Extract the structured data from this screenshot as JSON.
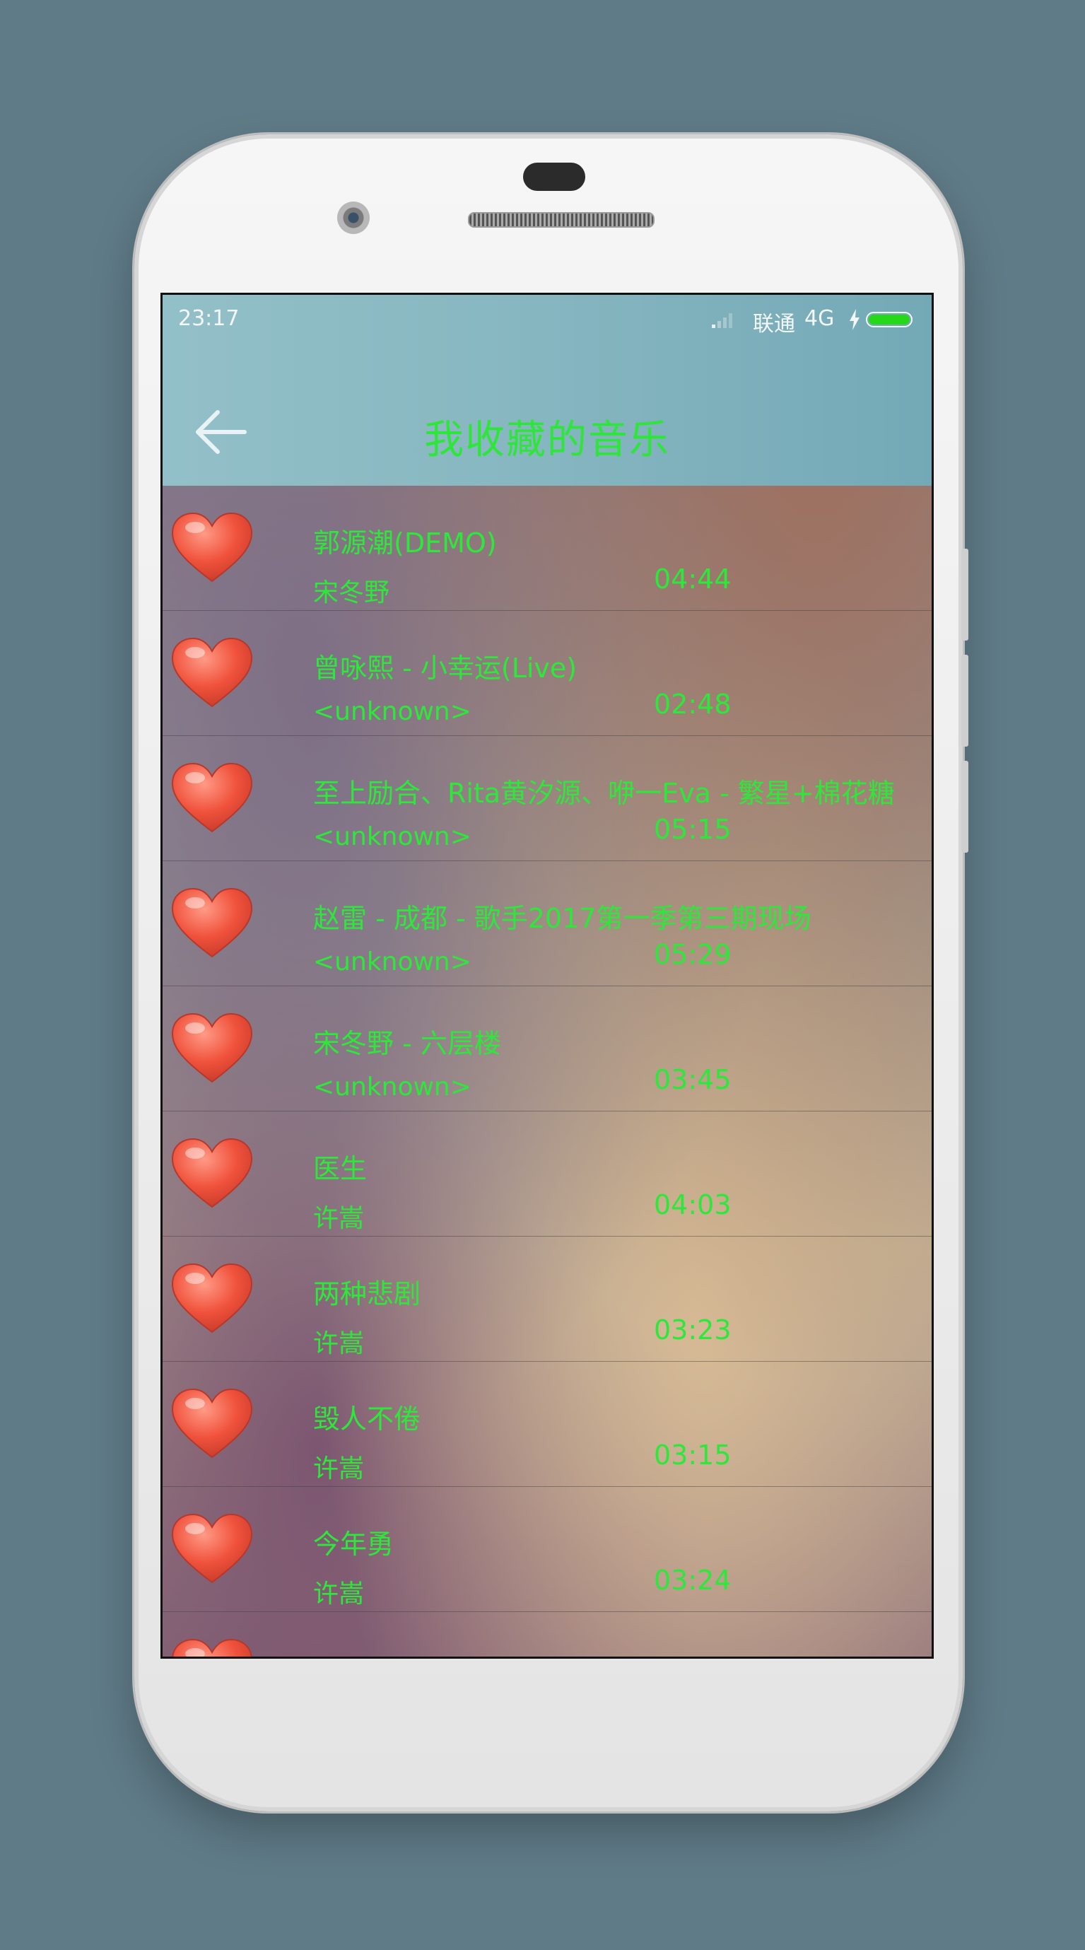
{
  "status_bar": {
    "time": "23:17",
    "carrier": "联通",
    "network": "4G",
    "battery_color": "#27d81a"
  },
  "header": {
    "title": "我收藏的音乐",
    "back_icon": "arrow-left-icon",
    "title_color": "#2ee63a"
  },
  "songs": [
    {
      "title": "郭源潮(DEMO)",
      "artist": "宋冬野",
      "duration": "04:44"
    },
    {
      "title": "曾咏熙 - 小幸运(Live)",
      "artist": "<unknown>",
      "duration": "02:48"
    },
    {
      "title": "至上励合、Rita黄汐源、咿一Eva - 繁星+棉花糖",
      "artist": "<unknown>",
      "duration": "05:15"
    },
    {
      "title": "赵雷 - 成都 - 歌手2017第一季第三期现场",
      "artist": "<unknown>",
      "duration": "05:29"
    },
    {
      "title": "宋冬野 - 六层楼",
      "artist": "<unknown>",
      "duration": "03:45"
    },
    {
      "title": "医生",
      "artist": "许嵩",
      "duration": "04:03"
    },
    {
      "title": "两种悲剧",
      "artist": "许嵩",
      "duration": "03:23"
    },
    {
      "title": "毁人不倦",
      "artist": "许嵩",
      "duration": "03:15"
    },
    {
      "title": "今年勇",
      "artist": "许嵩",
      "duration": "03:24"
    }
  ],
  "favorite_icon": "heart-icon",
  "text_color": "#2de83a"
}
